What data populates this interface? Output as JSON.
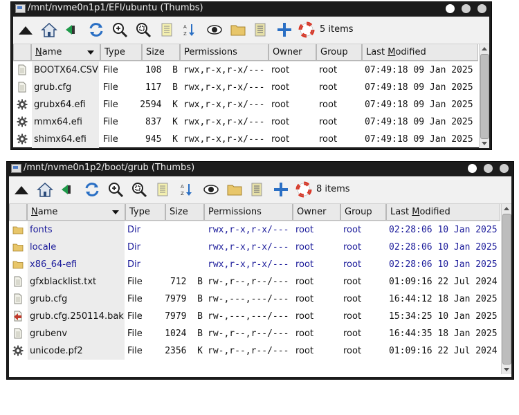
{
  "window1": {
    "title": "/mnt/nvme0n1p1/EFI/ubuntu (Thumbs)",
    "item_count": "5 items",
    "columns": {
      "name": "Name",
      "type": "Type",
      "size": "Size",
      "permissions": "Permissions",
      "owner": "Owner",
      "group": "Group",
      "modified": "Last Modified"
    },
    "rows": [
      {
        "name": "BOOTX64.CSV",
        "type": "File",
        "size": "108  B",
        "permissions": "rwx,r-x,r-x/---",
        "owner": "root",
        "group": "root",
        "modified": "07:49:18 09 Jan 2025",
        "icon": "text-file-icon"
      },
      {
        "name": "grub.cfg",
        "type": "File",
        "size": "117  B",
        "permissions": "rwx,r-x,r-x/---",
        "owner": "root",
        "group": "root",
        "modified": "07:49:18 09 Jan 2025",
        "icon": "text-file-icon"
      },
      {
        "name": "grubx64.efi",
        "type": "File",
        "size": "2594  K",
        "permissions": "rwx,r-x,r-x/---",
        "owner": "root",
        "group": "root",
        "modified": "07:49:18 09 Jan 2025",
        "icon": "gear-icon"
      },
      {
        "name": "mmx64.efi",
        "type": "File",
        "size": "837  K",
        "permissions": "rwx,r-x,r-x/---",
        "owner": "root",
        "group": "root",
        "modified": "07:49:18 09 Jan 2025",
        "icon": "gear-icon"
      },
      {
        "name": "shimx64.efi",
        "type": "File",
        "size": "945  K",
        "permissions": "rwx,r-x,r-x/---",
        "owner": "root",
        "group": "root",
        "modified": "07:49:18 09 Jan 2025",
        "icon": "gear-icon"
      }
    ]
  },
  "window2": {
    "title": "/mnt/nvme0n1p2/boot/grub (Thumbs)",
    "item_count": "8 items",
    "columns": {
      "name": "Name",
      "type": "Type",
      "size": "Size",
      "permissions": "Permissions",
      "owner": "Owner",
      "group": "Group",
      "modified": "Last Modified"
    },
    "rows": [
      {
        "name": "fonts",
        "type": "Dir",
        "size": "",
        "permissions": "rwx,r-x,r-x/---",
        "owner": "root",
        "group": "root",
        "modified": "02:28:06 10 Jan 2025",
        "icon": "folder-icon",
        "dir": true
      },
      {
        "name": "locale",
        "type": "Dir",
        "size": "",
        "permissions": "rwx,r-x,r-x/---",
        "owner": "root",
        "group": "root",
        "modified": "02:28:06 10 Jan 2025",
        "icon": "folder-icon",
        "dir": true
      },
      {
        "name": "x86_64-efi",
        "type": "Dir",
        "size": "",
        "permissions": "rwx,r-x,r-x/---",
        "owner": "root",
        "group": "root",
        "modified": "02:28:06 10 Jan 2025",
        "icon": "folder-icon",
        "dir": true
      },
      {
        "name": "gfxblacklist.txt",
        "type": "File",
        "size": "712  B",
        "permissions": "rw-,r--,r--/---",
        "owner": "root",
        "group": "root",
        "modified": "01:09:16 22 Jul 2024",
        "icon": "text-file-icon"
      },
      {
        "name": "grub.cfg",
        "type": "File",
        "size": "7979  B",
        "permissions": "rw-,---,---/---",
        "owner": "root",
        "group": "root",
        "modified": "16:44:12 18 Jan 2025",
        "icon": "text-file-icon"
      },
      {
        "name": "grub.cfg.250114.bak",
        "type": "File",
        "size": "7979  B",
        "permissions": "rw-,---,---/---",
        "owner": "root",
        "group": "root",
        "modified": "15:34:25 10 Jan 2025",
        "icon": "backup-file-icon"
      },
      {
        "name": "grubenv",
        "type": "File",
        "size": "1024  B",
        "permissions": "rw-,r--,r--/---",
        "owner": "root",
        "group": "root",
        "modified": "16:44:35 18 Jan 2025",
        "icon": "text-file-icon"
      },
      {
        "name": "unicode.pf2",
        "type": "File",
        "size": "2356  K",
        "permissions": "rw-,r--,r--/---",
        "owner": "root",
        "group": "root",
        "modified": "01:09:16 22 Jul 2024",
        "icon": "gear-icon"
      }
    ]
  },
  "toolbar_icons": [
    "up-icon",
    "home-icon",
    "back-icon",
    "refresh-icon",
    "zoom-in-icon",
    "zoom-fit-icon",
    "list-icon",
    "sort-icon",
    "eye-icon",
    "folder-icon",
    "details-icon",
    "add-icon",
    "help-icon"
  ],
  "colors": {
    "titlebar": "#1c1c1c",
    "dir_text": "#1a1a9a",
    "toolbar_bg": "#f1f1f1"
  }
}
